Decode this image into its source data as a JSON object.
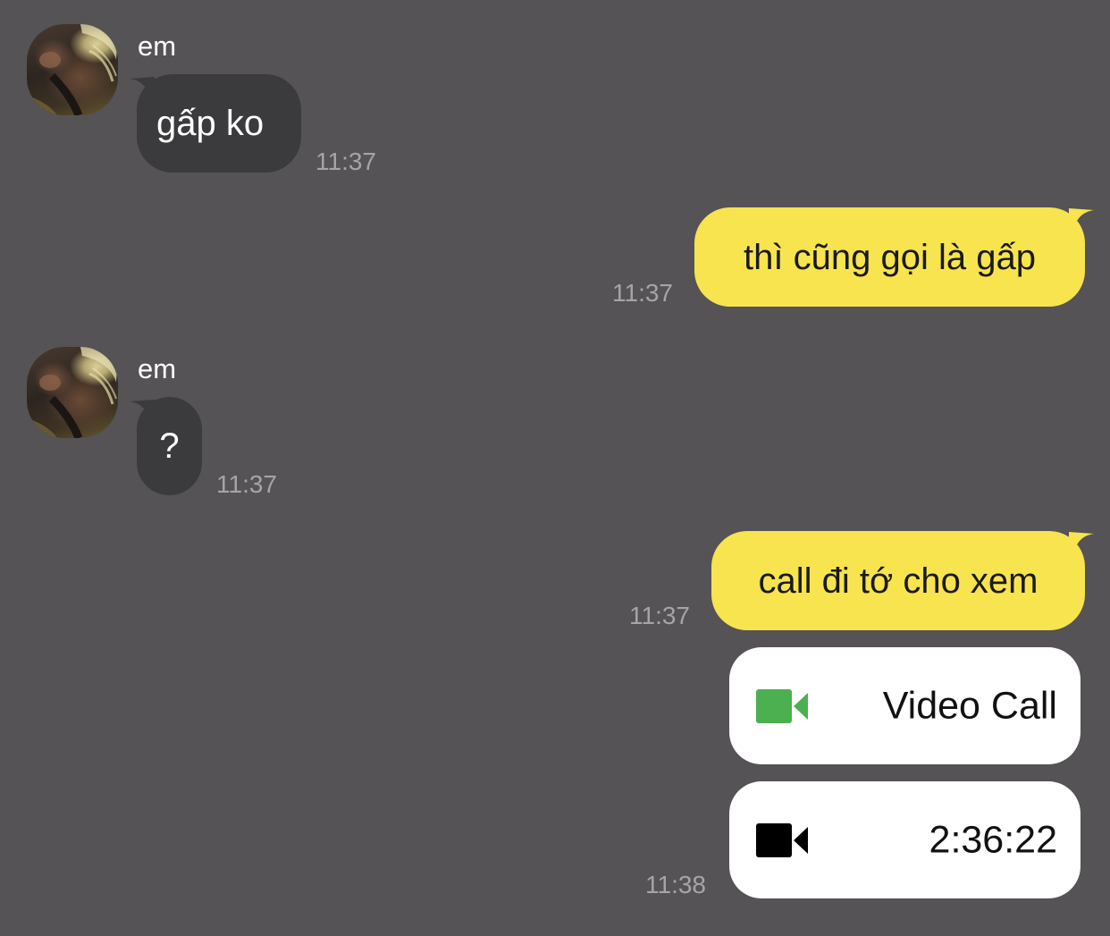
{
  "colors": {
    "background": "#555355",
    "incoming_bubble": "#3b3a3c",
    "outgoing_bubble": "#f7e44e",
    "timestamp": "#a6a4a7",
    "video_call_icon": "#4cb050",
    "call_duration_icon": "#000000"
  },
  "messages": [
    {
      "direction": "incoming",
      "sender": "em",
      "text": "gấp ko",
      "time": "11:37"
    },
    {
      "direction": "outgoing",
      "text": "thì cũng gọi là gấp",
      "time": "11:37"
    },
    {
      "direction": "incoming",
      "sender": "em",
      "text": "?",
      "time": "11:37"
    },
    {
      "direction": "outgoing",
      "text": "call đi tớ cho xem",
      "time": "11:37"
    }
  ],
  "call_cards": [
    {
      "icon": "video-camera-icon",
      "label": "Video Call"
    },
    {
      "icon": "video-camera-icon",
      "label": "2:36:22",
      "time": "11:38"
    }
  ]
}
